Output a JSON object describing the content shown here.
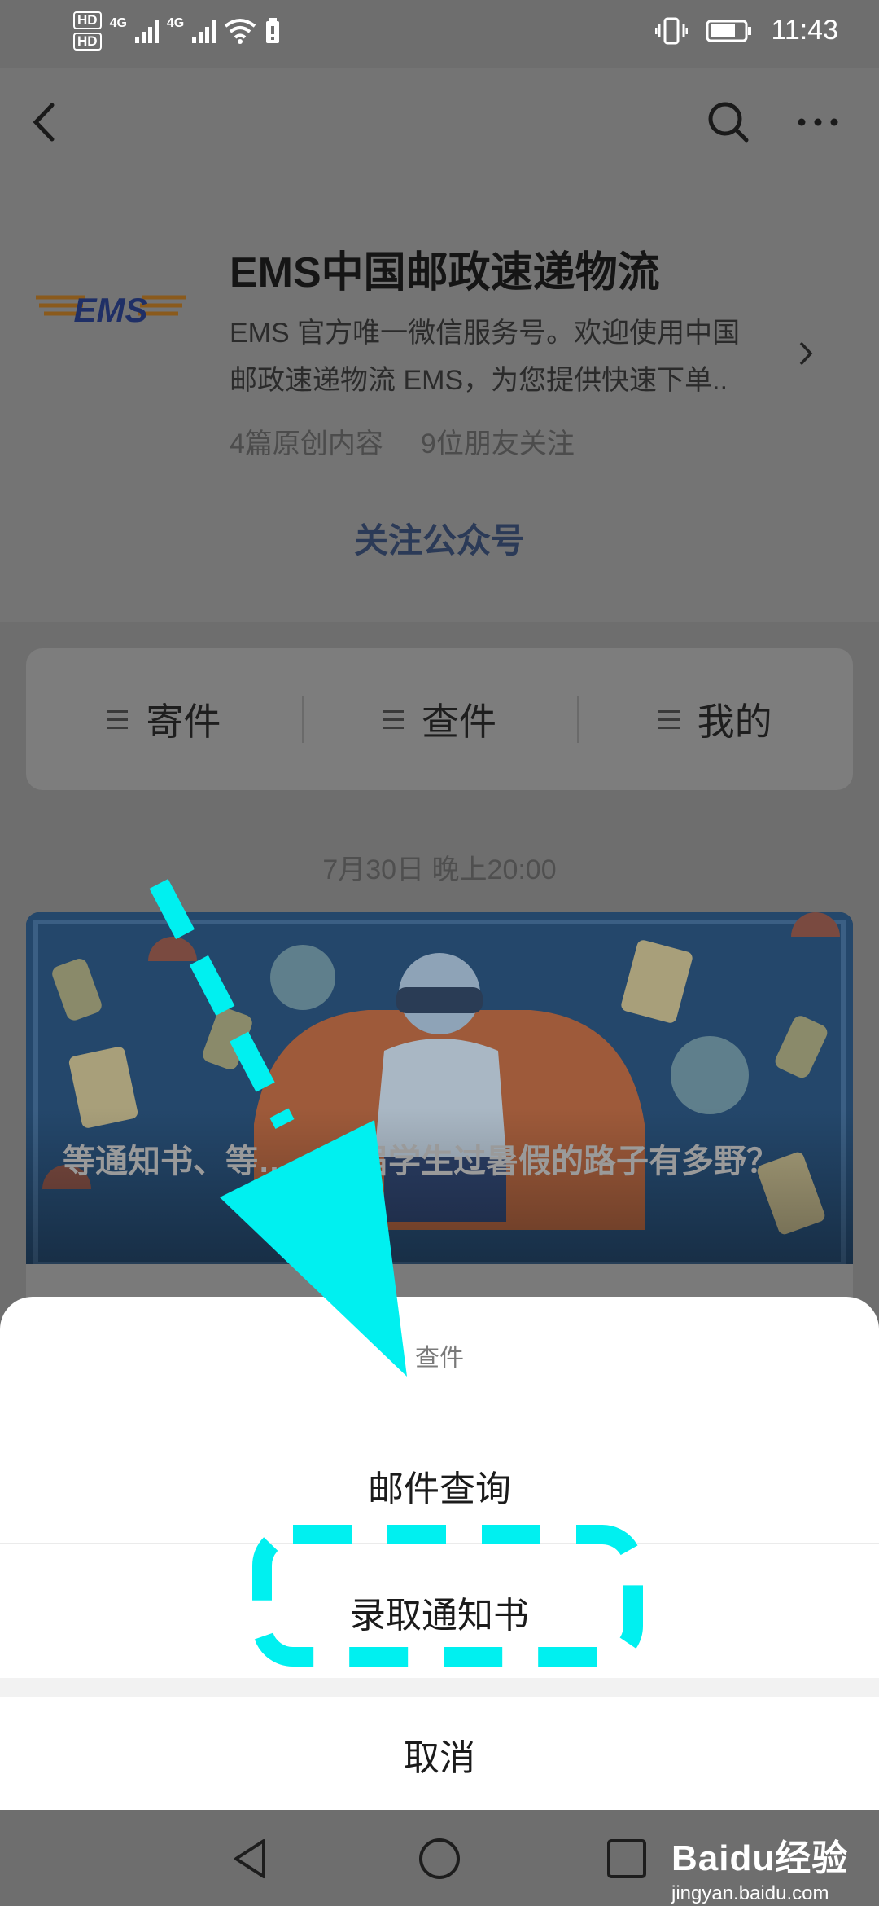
{
  "status_bar": {
    "hd1": "HD",
    "hd2": "HD",
    "net1": "4G",
    "net2": "4G",
    "time": "11:43"
  },
  "header": {
    "back_icon": "chevron-left-icon",
    "search_icon": "search-icon",
    "more_icon": "more-horizontal-icon"
  },
  "account": {
    "logo_text": "EMS",
    "name": "EMS中国邮政速递物流",
    "description_line1": "EMS 官方唯一微信服务号。欢迎使用中国",
    "description_line2": "邮政速递物流 EMS，为您提供快速下单..",
    "original_count": "4篇原创内容",
    "friends_following": "9位朋友关注",
    "follow_button": "关注公众号"
  },
  "menu": {
    "items": [
      {
        "label": "寄件",
        "icon": "menu-lines-icon"
      },
      {
        "label": "查件",
        "icon": "menu-lines-icon"
      },
      {
        "label": "我的",
        "icon": "menu-lines-icon"
      }
    ]
  },
  "feed": {
    "date": "7月30日 晚上20:00",
    "article_title": "等通知书、等……这届学生过暑假的路子有多野？"
  },
  "sheet": {
    "title": "查件",
    "options": [
      "邮件查询",
      "录取通知书"
    ],
    "cancel": "取消"
  },
  "navbar": {
    "back_icon": "triangle-back-icon",
    "home_icon": "circle-home-icon",
    "recent_icon": "square-recents-icon"
  },
  "watermark": {
    "brand": "Baidu经验",
    "url": "jingyan.baidu.com"
  },
  "colors": {
    "overlay": "#6e6e6e",
    "annotation": "#00f0f0",
    "sheet_bg": "#ffffff"
  }
}
